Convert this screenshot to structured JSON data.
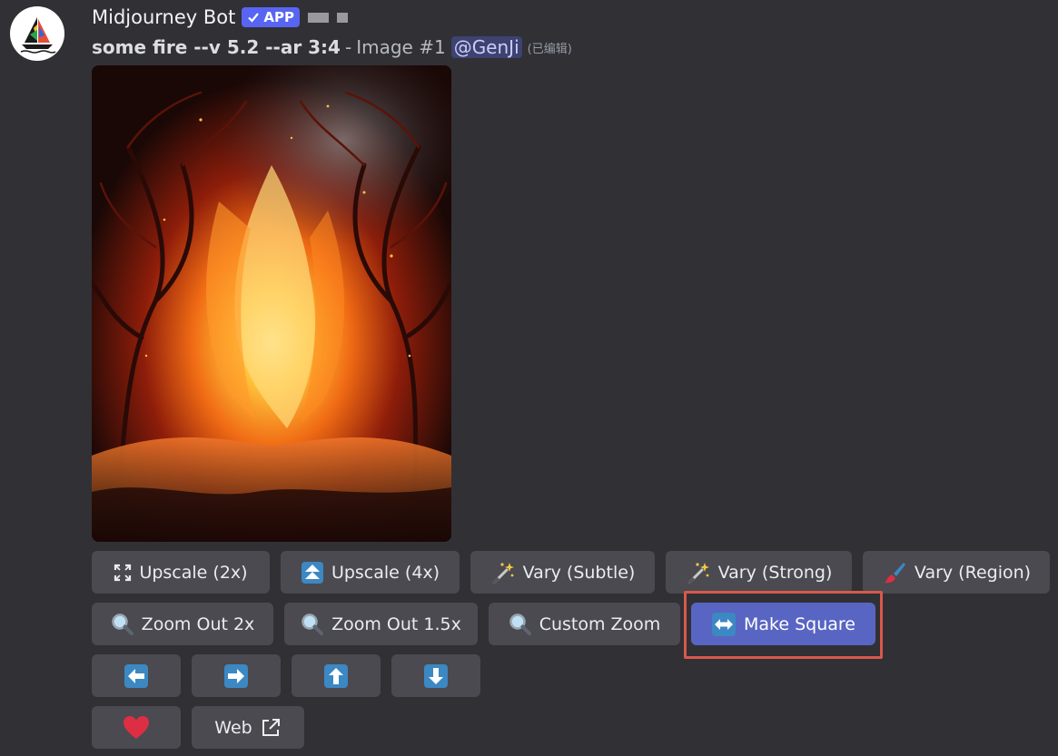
{
  "author": {
    "name": "Midjourney Bot",
    "badge": "APP"
  },
  "message": {
    "prompt": "some fire --v 5.2 --ar 3:4",
    "separator": "-",
    "image_label": "Image #1",
    "mention": "@GenJi",
    "edited": "(已编辑)"
  },
  "buttons": {
    "upscale_2x": "Upscale (2x)",
    "upscale_4x": "Upscale (4x)",
    "vary_subtle": "Vary (Subtle)",
    "vary_strong": "Vary (Strong)",
    "vary_region": "Vary (Region)",
    "zoom_out_2x": "Zoom Out 2x",
    "zoom_out_15x": "Zoom Out 1.5x",
    "custom_zoom": "Custom Zoom",
    "make_square": "Make Square",
    "web": "Web"
  },
  "icons": {
    "upscale_2x": "expand-corners-icon",
    "upscale_4x": "double-up-arrow-icon",
    "vary": "magic-wand-icon",
    "vary_region": "paintbrush-icon",
    "zoom": "magnifying-glass-icon",
    "make_square": "left-right-arrow-icon",
    "pan": [
      "arrow-left-icon",
      "arrow-right-icon",
      "arrow-up-icon",
      "arrow-down-icon"
    ],
    "favorite": "heart-icon",
    "external": "external-link-icon"
  },
  "colors": {
    "background": "#313035",
    "button": "#4a4a50",
    "primary_button": "#5865c3",
    "app_badge": "#5865f2",
    "highlight": "#d8594c",
    "heart": "#dd2e44",
    "emoji_blue": "#3b88c3"
  }
}
